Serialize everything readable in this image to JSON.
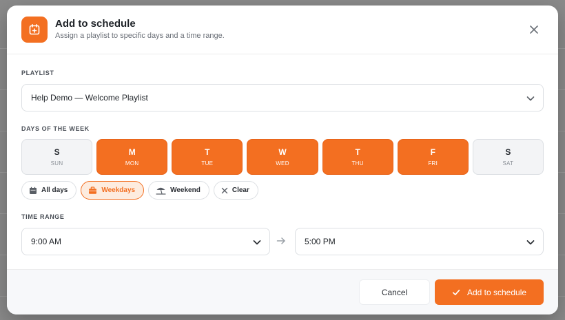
{
  "modal": {
    "title": "Add to schedule",
    "subtitle": "Assign a playlist to specific days and a time range."
  },
  "playlist": {
    "label": "PLAYLIST",
    "value": "Help Demo — Welcome Playlist"
  },
  "days": {
    "label": "DAYS OF THE WEEK",
    "items": [
      {
        "letter": "S",
        "abbr": "SUN",
        "selected": false
      },
      {
        "letter": "M",
        "abbr": "MON",
        "selected": true
      },
      {
        "letter": "T",
        "abbr": "TUE",
        "selected": true
      },
      {
        "letter": "W",
        "abbr": "WED",
        "selected": true
      },
      {
        "letter": "T",
        "abbr": "THU",
        "selected": true
      },
      {
        "letter": "F",
        "abbr": "FRI",
        "selected": true
      },
      {
        "letter": "S",
        "abbr": "SAT",
        "selected": false
      }
    ]
  },
  "presets": [
    {
      "label": "All days",
      "icon": "calendar-icon",
      "active": false
    },
    {
      "label": "Weekdays",
      "icon": "briefcase-icon",
      "active": true
    },
    {
      "label": "Weekend",
      "icon": "beach-umbrella-icon",
      "active": false
    },
    {
      "label": "Clear",
      "icon": "close-icon",
      "active": false
    }
  ],
  "time_range": {
    "label": "TIME RANGE",
    "start": "9:00 AM",
    "end": "5:00 PM"
  },
  "footer": {
    "cancel_label": "Cancel",
    "submit_label": "Add to schedule"
  },
  "colors": {
    "accent": "#f36f21",
    "accent_light": "#fdecdf"
  }
}
